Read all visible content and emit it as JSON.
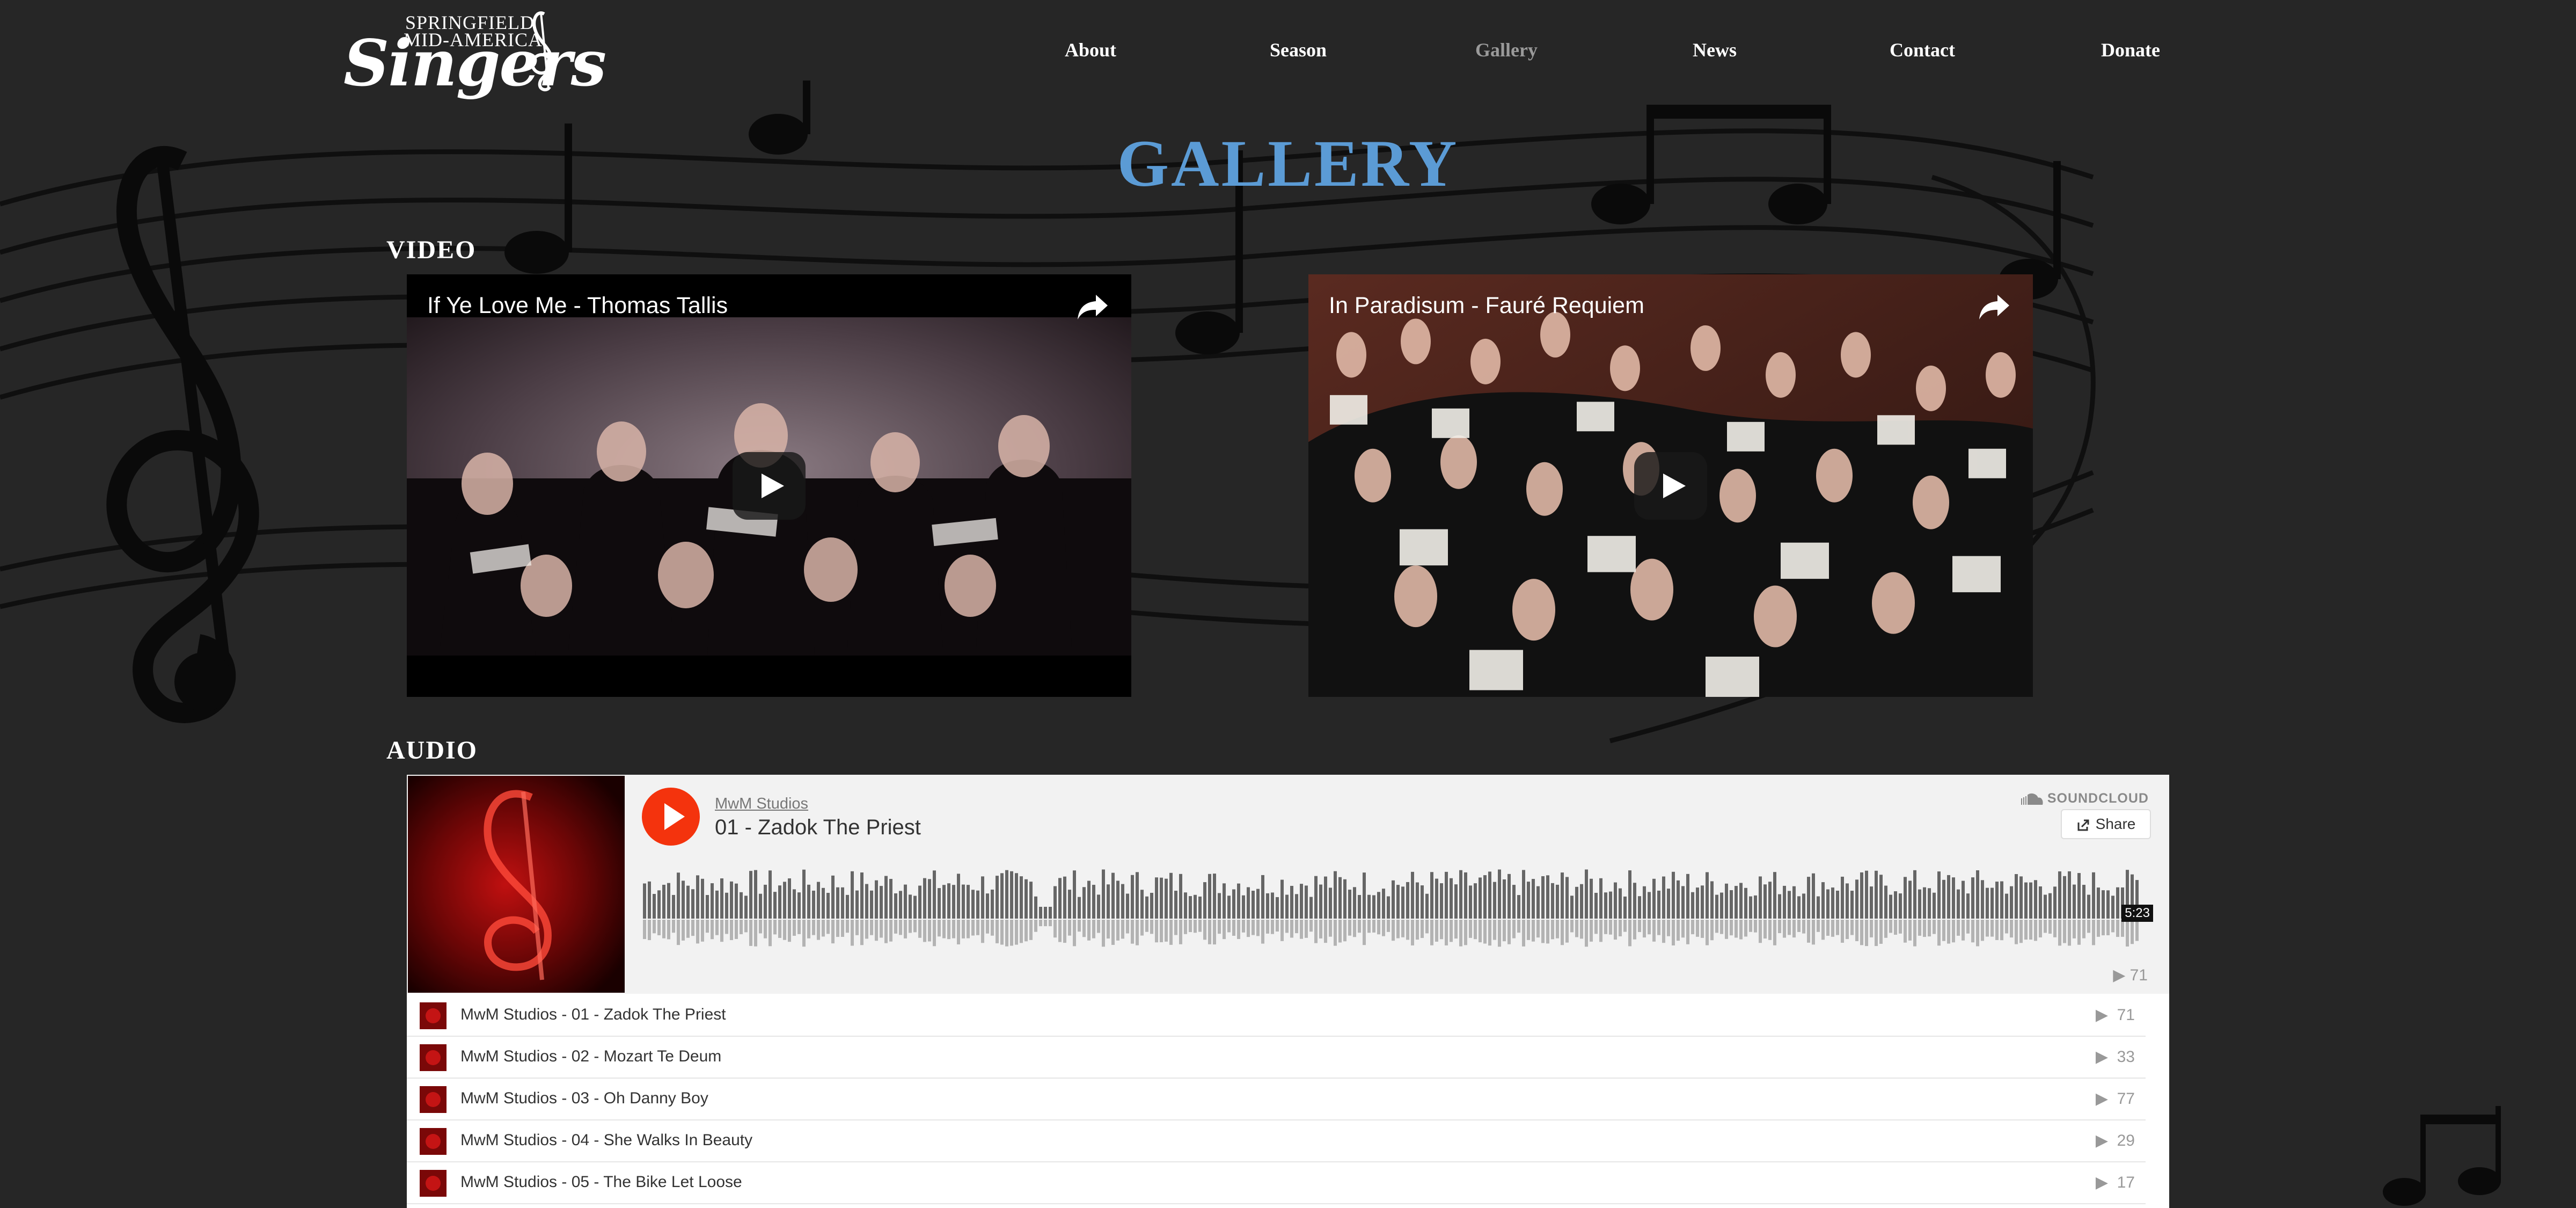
{
  "logo": {
    "line1": "SPRINGFIELD",
    "line2": "MID-AMERICA",
    "line3": "Singers",
    "icon": "treble-clef-icon"
  },
  "nav": {
    "items": [
      {
        "label": "About"
      },
      {
        "label": "Season"
      },
      {
        "label": "Gallery",
        "active": true
      },
      {
        "label": "News"
      },
      {
        "label": "Contact"
      },
      {
        "label": "Donate"
      }
    ]
  },
  "page": {
    "title": "GALLERY",
    "video_heading": "VIDEO",
    "audio_heading": "AUDIO"
  },
  "videos": [
    {
      "title": "If Ye Love Me - Thomas Tallis"
    },
    {
      "title": "In Paradisum - Fauré Requiem"
    }
  ],
  "soundcloud": {
    "user": "MwM Studios",
    "track": "01 - Zadok The Priest",
    "brand": "SOUNDCLOUD",
    "share_label": "Share",
    "duration": "5:23",
    "play_count": "71",
    "tracks": [
      {
        "name": "MwM Studios - 01 - Zadok The Priest",
        "plays": "71"
      },
      {
        "name": "MwM Studios - 02 - Mozart Te Deum",
        "plays": "33"
      },
      {
        "name": "MwM Studios - 03 - Oh Danny Boy",
        "plays": "77"
      },
      {
        "name": "MwM Studios - 04 - She Walks In Beauty",
        "plays": "29"
      },
      {
        "name": "MwM Studios - 05 - The Bike Let Loose",
        "plays": "17"
      }
    ]
  },
  "colors": {
    "background": "#262626",
    "title_blue": "#5b9bd5",
    "soundcloud_orange": "#f4330d"
  }
}
